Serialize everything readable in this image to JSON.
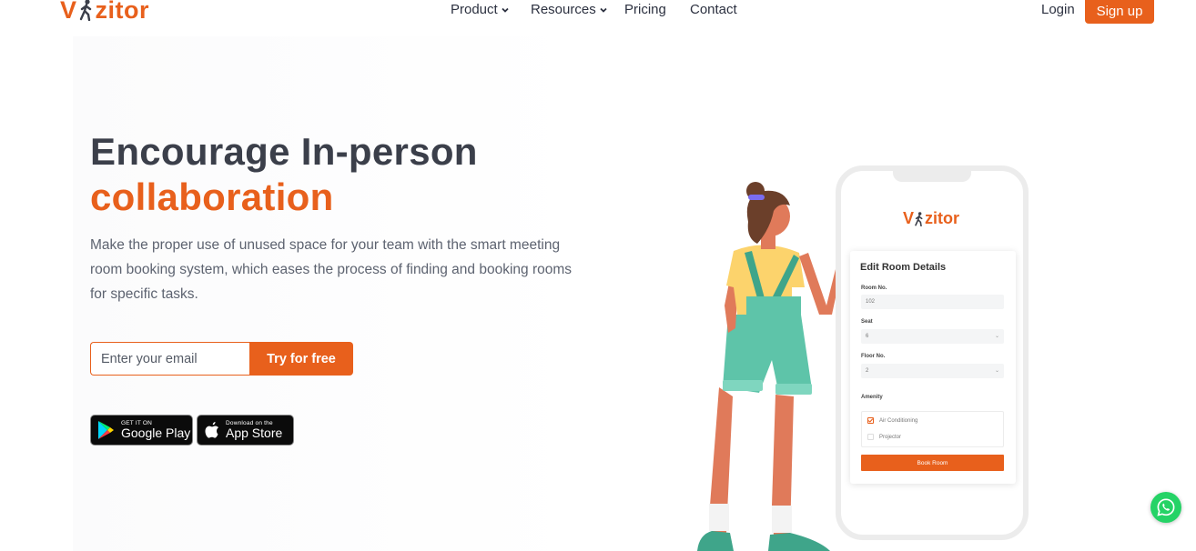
{
  "header": {
    "logo_text_pre": "V",
    "logo_text_post": "zitor",
    "nav": [
      {
        "label": "Product",
        "has_dropdown": true
      },
      {
        "label": "Resources",
        "has_dropdown": true
      },
      {
        "label": "Pricing",
        "has_dropdown": false
      },
      {
        "label": "Contact",
        "has_dropdown": false
      }
    ],
    "login_label": "Login",
    "signup_label": "Sign up"
  },
  "hero": {
    "title_line1": "Encourage In-person",
    "title_line2": "collaboration",
    "description": "Make the proper use of unused space for your team with the smart meeting room booking system, which eases the process of finding and booking rooms for specific tasks.",
    "email_placeholder": "Enter your email",
    "cta_label": "Try for free",
    "google_play": {
      "small": "GET IT ON",
      "big": "Google Play"
    },
    "app_store": {
      "small": "Download on the",
      "big": "App Store"
    }
  },
  "phone": {
    "logo_pre": "V",
    "logo_post": "zitor",
    "card_title": "Edit Room Details",
    "fields": [
      {
        "label": "Room No.",
        "value": "102"
      },
      {
        "label": "Seat",
        "value": "6"
      },
      {
        "label": "Floor No.",
        "value": "2"
      }
    ],
    "amenity_label": "Amenity",
    "amenities": [
      {
        "label": "Air Conditioning",
        "checked": true
      },
      {
        "label": "Projector",
        "checked": false
      }
    ],
    "book_label": "Book Room"
  },
  "colors": {
    "accent": "#e8601c",
    "heading": "#3b3f4a",
    "whatsapp": "#25d366"
  },
  "icons": [
    "walker-logo-icon",
    "chevron-down-icon",
    "google-play-icon",
    "apple-icon",
    "whatsapp-icon"
  ]
}
